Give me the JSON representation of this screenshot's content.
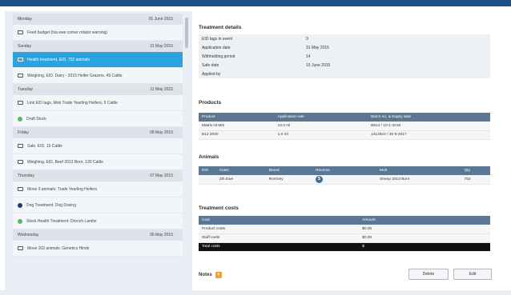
{
  "colors": {
    "topbar": "#1c4f86",
    "selected": "#2aa3de",
    "table_header": "#5b7794"
  },
  "list": [
    {
      "kind": "day",
      "day": "Monday",
      "date": "01 June 2015"
    },
    {
      "kind": "item",
      "icon": "monitor-icon",
      "text": "Feed budget (hia ewe comer rotator warning)",
      "selected": false
    },
    {
      "kind": "day",
      "day": "Sunday",
      "date": "31 May 2015"
    },
    {
      "kind": "item",
      "icon": "monitor-icon",
      "text": "Health treatment, EID, 752 animals",
      "selected": true
    },
    {
      "kind": "item",
      "icon": "monitor-icon",
      "text": "Weighing, EID, Dairy - 2015 Heifer Grazers, 49 Cattle",
      "selected": false
    },
    {
      "kind": "day",
      "day": "Tuesday",
      "date": "11 May 2015"
    },
    {
      "kind": "item",
      "icon": "monitor-icon",
      "text": "Link EID tags, Mob Trade Yearling Heifers, 6 Cattle",
      "selected": false
    },
    {
      "kind": "item",
      "icon": "green-dot-icon",
      "text": "Draft Stock",
      "selected": false
    },
    {
      "kind": "day",
      "day": "Friday",
      "date": "08 May 2015"
    },
    {
      "kind": "item",
      "icon": "monitor-icon",
      "text": "Sale, EID, 15 Cattle",
      "selected": false
    },
    {
      "kind": "item",
      "icon": "monitor-icon",
      "text": "Weighing, EID, Beef 2013 Born, 130 Cattle",
      "selected": false
    },
    {
      "kind": "day",
      "day": "Thursday",
      "date": "07 May 2015"
    },
    {
      "kind": "item",
      "icon": "monitor-icon",
      "text": "Move 3 animals: Trade Yearling Heifers",
      "selected": false
    },
    {
      "kind": "item",
      "icon": "navy-dot-icon",
      "text": "Dog Treatment: Dog Dosing",
      "selected": false
    },
    {
      "kind": "item",
      "icon": "green-dot-icon",
      "text": "Stock Health Treatment: Drench Lambs",
      "selected": false
    },
    {
      "kind": "day",
      "day": "Wednesday",
      "date": "06 May 2015"
    },
    {
      "kind": "item",
      "icon": "monitor-icon",
      "text": "Move 103 animals: Genetics Hinds",
      "selected": false
    }
  ],
  "treatment": {
    "title": "Treatment details",
    "rows": [
      {
        "k": "EID tags in event",
        "v": "0"
      },
      {
        "k": "Application date",
        "v": "31 May 2015"
      },
      {
        "k": "Withholding period",
        "v": "14"
      },
      {
        "k": "Safe date",
        "v": "15 June 2015"
      },
      {
        "k": "Applied by",
        "v": ""
      }
    ]
  },
  "products": {
    "title": "Products",
    "headers": [
      "Product",
      "Application rate",
      "Batch no. & Expiry date"
    ],
    "rows": [
      [
        "Matrix Hi-Min",
        "14.0 ml",
        "B914 / 10-1-2016"
      ],
      [
        "B12 2000",
        "1.0 ml",
        "1412924 / 30-6-2017"
      ]
    ]
  },
  "animals": {
    "title": "Animals",
    "headers": [
      "EID",
      "Class",
      "Breed",
      "Reverse",
      "Mob",
      "Qty"
    ],
    "rows": [
      [
        "",
        "2th Ewe",
        "Romney",
        "S",
        "Sheep 2013 Born",
        "752"
      ]
    ]
  },
  "costs": {
    "title": "Treatment costs",
    "headers": [
      "Cost",
      "Amount"
    ],
    "rows": [
      [
        "Product costs",
        "$0.00"
      ],
      [
        "Staff costs",
        "$0.00"
      ]
    ],
    "total": [
      "Total costs",
      "$"
    ]
  },
  "notes_label": "Notes",
  "buttons": {
    "delete": "Delete",
    "edit": "Edit"
  }
}
